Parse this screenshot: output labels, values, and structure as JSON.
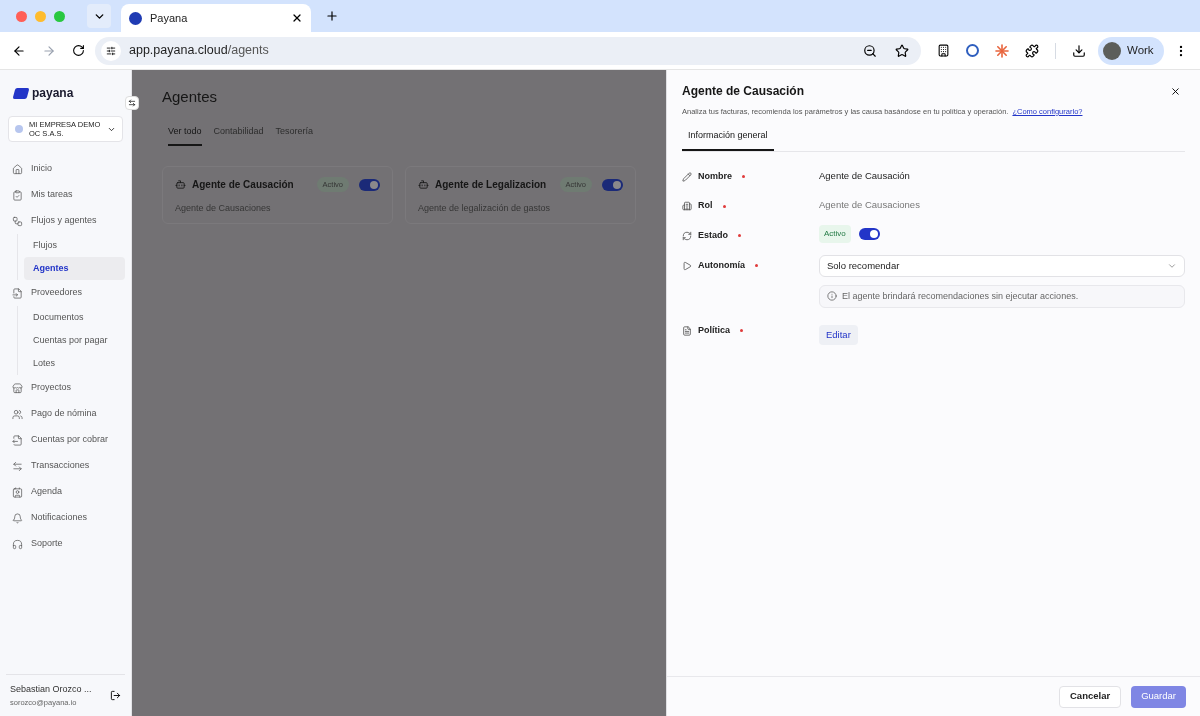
{
  "browser": {
    "tab_title": "Payana",
    "url_host": "app.payana.cloud",
    "url_path": "/agents",
    "profile": "Work"
  },
  "sidebar": {
    "logo": "payana",
    "company": "MI EMPRESA DEMO OC S.A.S.",
    "items": [
      {
        "label": "Inicio",
        "selected": false
      },
      {
        "label": "Mis tareas",
        "selected": false
      },
      {
        "label": "Flujos y agentes",
        "selected": false,
        "children": [
          {
            "label": "Flujos",
            "selected": false
          },
          {
            "label": "Agentes",
            "selected": true
          }
        ]
      },
      {
        "label": "Proveedores",
        "selected": false,
        "children": [
          {
            "label": "Documentos",
            "selected": false
          },
          {
            "label": "Cuentas por pagar",
            "selected": false
          },
          {
            "label": "Lotes",
            "selected": false
          }
        ]
      },
      {
        "label": "Proyectos",
        "selected": false
      },
      {
        "label": "Pago de nómina",
        "selected": false
      },
      {
        "label": "Cuentas por cobrar",
        "selected": false
      },
      {
        "label": "Transacciones",
        "selected": false
      },
      {
        "label": "Agenda",
        "selected": false
      },
      {
        "label": "Notificaciones",
        "selected": false
      },
      {
        "label": "Soporte",
        "selected": false
      }
    ],
    "user_name": "Sebastian Orozco ...",
    "user_email": "sorozco@payana.io"
  },
  "main": {
    "title": "Agentes",
    "tabs": [
      {
        "label": "Ver todo",
        "selected": true
      },
      {
        "label": "Contabilidad",
        "selected": false
      },
      {
        "label": "Tesorería",
        "selected": false
      }
    ],
    "cards": [
      {
        "title": "Agente de Causación",
        "status": "Activo",
        "on": true,
        "description": "Agente de Causaciones"
      },
      {
        "title": "Agente de Legalizacion",
        "status": "Activo",
        "on": true,
        "description": "Agente de legalización de gastos"
      }
    ]
  },
  "panel": {
    "title": "Agente de Causación",
    "description": "Analiza tus facturas, recomienda los parámetros y las causa basándose en tu política y operación.",
    "help_link": "¿Como configurarlo?",
    "tabs": [
      {
        "label": "Información general",
        "selected": true
      }
    ],
    "fields": [
      {
        "kind": "text",
        "label": "Nombre",
        "required": true,
        "value": "Agente de Causación"
      },
      {
        "kind": "readonly",
        "label": "Rol",
        "required": true,
        "value": "Agente de Causaciones"
      },
      {
        "kind": "status",
        "label": "Estado",
        "required": true,
        "badge": "Activo",
        "on": true
      },
      {
        "kind": "select",
        "label": "Autonomía",
        "required": true,
        "value": "Solo recomendar",
        "hint": "El agente brindará recomendaciones sin ejecutar acciones."
      },
      {
        "kind": "action",
        "label": "Política",
        "required": true,
        "button": "Editar"
      }
    ],
    "buttons": [
      {
        "label": "Cancelar",
        "kind": "secondary"
      },
      {
        "label": "Guardar",
        "kind": "primary"
      }
    ]
  }
}
